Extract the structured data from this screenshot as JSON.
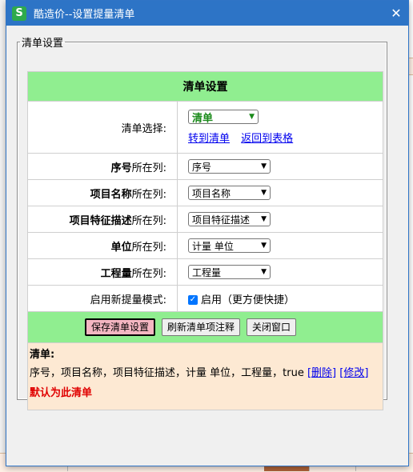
{
  "window": {
    "title": "酷造价--设置提量清单",
    "app_icon_letter": "S",
    "close_glyph": "✕"
  },
  "group": {
    "legend": "清单设置"
  },
  "table": {
    "header": "清单设置",
    "list_select": {
      "label": "清单选择:",
      "value": "清单",
      "goto_link": "转到清单",
      "back_link": "返回到表格"
    },
    "rows": [
      {
        "label_bold": "序号",
        "label_rest": "所在列:",
        "value": "序号"
      },
      {
        "label_bold": "项目名称",
        "label_rest": "所在列:",
        "value": "项目名称"
      },
      {
        "label_bold": "项目特征描述",
        "label_rest": "所在列:",
        "value": "项目特征描述"
      },
      {
        "label_bold": "单位",
        "label_rest": "所在列:",
        "value": "计量 单位"
      },
      {
        "label_bold": "工程量",
        "label_rest": "所在列:",
        "value": "工程量"
      }
    ],
    "mode": {
      "label": "启用新提量模式:",
      "checked": true,
      "checkbox_label": "启用（更方便快捷）"
    },
    "buttons": {
      "save": "保存清单设置",
      "refresh": "刷新清单项注释",
      "close": "关闭窗口"
    },
    "list_info": {
      "title": "清单:",
      "content": "序号，项目名称，项目特征描述，计量 单位，工程量，true",
      "delete_link": "[删除]",
      "edit_link": "[修改]",
      "default_note": "默认为此清单"
    }
  },
  "colors": {
    "titlebar": "#2d74c6",
    "header_green": "#90ee90",
    "info_bg": "#fde9d3",
    "link": "#0000ee",
    "default_red": "#e00000"
  }
}
